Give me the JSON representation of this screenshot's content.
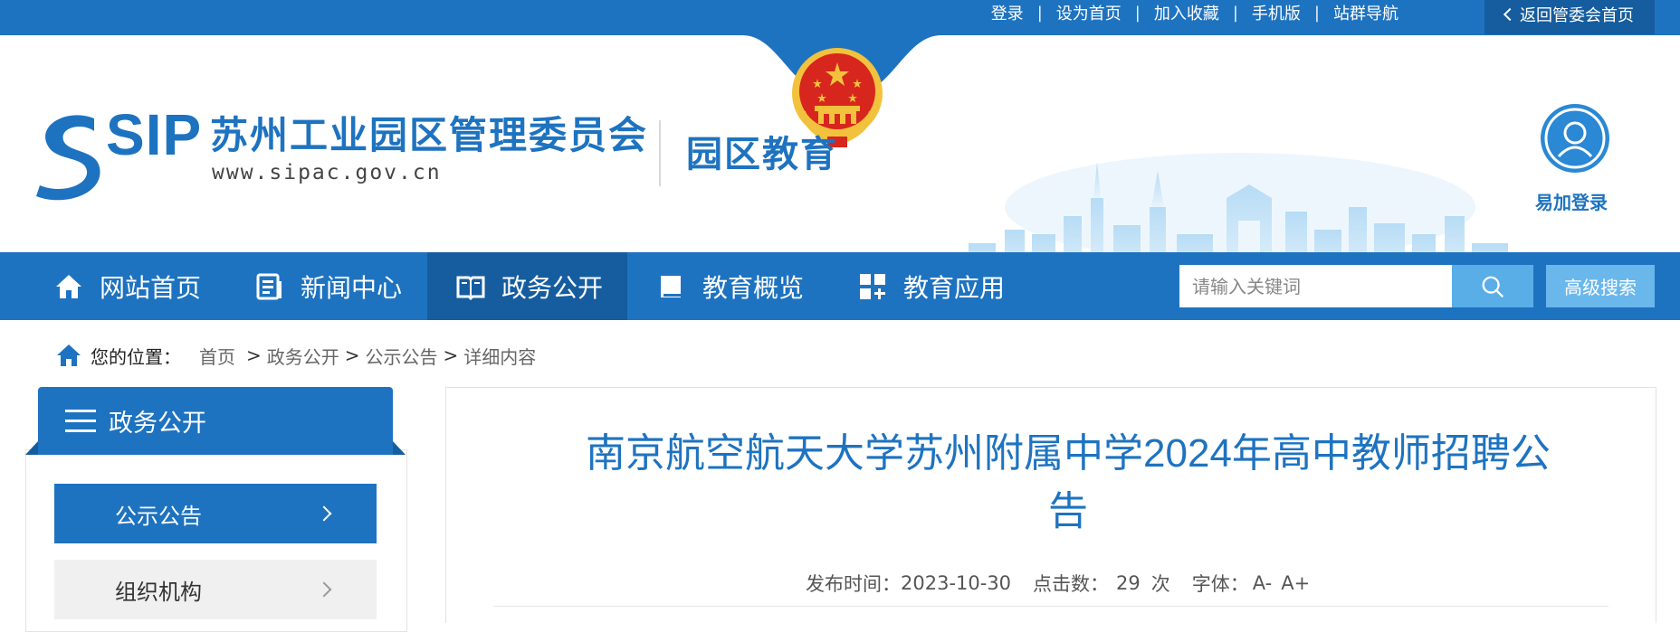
{
  "topbar": {
    "links": [
      "登录",
      "设为首页",
      "加入收藏",
      "手机版",
      "站群导航"
    ],
    "separator": "|",
    "back_home": "返回管委会首页"
  },
  "header": {
    "logo_abbr": "SIP",
    "org_name": "苏州工业园区管理委员会",
    "org_url": "www.sipac.gov.cn",
    "section_name": "园区教育",
    "login_label": "易加登录"
  },
  "nav": {
    "items": [
      {
        "label": "网站首页",
        "icon": "home-icon"
      },
      {
        "label": "新闻中心",
        "icon": "news-icon"
      },
      {
        "label": "政务公开",
        "icon": "book-icon",
        "active": true
      },
      {
        "label": "教育概览",
        "icon": "notebook-icon"
      },
      {
        "label": "教育应用",
        "icon": "apps-grid-icon"
      }
    ],
    "search_placeholder": "请输入关键词",
    "advanced_search": "高级搜索"
  },
  "breadcrumb": {
    "label": "您的位置：",
    "items": [
      "首页",
      "政务公开",
      "公示公告",
      "详细内容"
    ],
    "separator": ">"
  },
  "sidebar": {
    "title": "政务公开",
    "items": [
      {
        "label": "公示公告",
        "active": true
      },
      {
        "label": "组织机构",
        "active": false
      }
    ]
  },
  "article": {
    "title_line1": "南京航空航天大学苏州附属中学2024年高中教师招聘公",
    "title_line2": "告",
    "publish_label": "发布时间：",
    "publish_date": "2023-10-30",
    "clicks_label": "点击数：",
    "clicks": "29",
    "clicks_unit": "次",
    "font_label": "字体：",
    "font_small": "A-",
    "font_large": "A+"
  },
  "colors": {
    "primary": "#1e73c0",
    "primary_dark": "#155d9f",
    "search_button": "#5aaee8",
    "emblem_red": "#d7261e",
    "emblem_gold": "#f2c23c"
  }
}
